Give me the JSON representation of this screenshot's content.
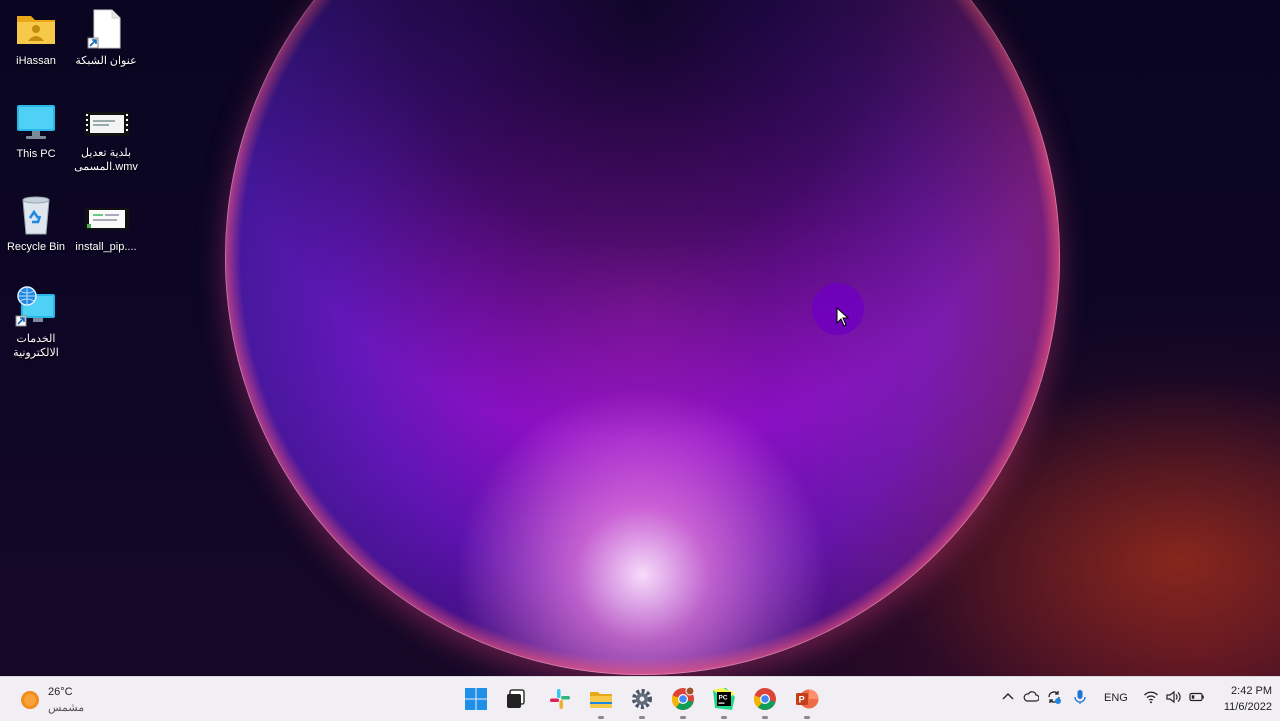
{
  "desktop_icons": [
    {
      "name": "user-folder",
      "label": "iHassan"
    },
    {
      "name": "network-address-shortcut",
      "label": "عنوان الشبكة"
    },
    {
      "name": "this-pc",
      "label": "This PC"
    },
    {
      "name": "video-file-wmv",
      "label_line1": "بلدية تعديل",
      "label_line2": "المسمى.wmv"
    },
    {
      "name": "recycle-bin",
      "label": "Recycle Bin"
    },
    {
      "name": "install-pip-file",
      "label": "install_pip...."
    },
    {
      "name": "e-services-shortcut",
      "label_line1": "الخدمات",
      "label_line2": "الالكترونية"
    }
  ],
  "taskbar": {
    "weather": {
      "temperature": "26°C",
      "condition": "مشمس",
      "icon": "sun-icon"
    },
    "pinned": [
      {
        "name": "start-button",
        "icon": "windows-logo-icon"
      },
      {
        "name": "task-view-button",
        "icon": "task-view-icon"
      },
      {
        "name": "slack-button",
        "icon": "slack-icon"
      },
      {
        "name": "file-explorer-button",
        "icon": "folder-icon"
      },
      {
        "name": "settings-button",
        "icon": "gear-icon"
      },
      {
        "name": "chrome-profile-button",
        "icon": "chrome-icon"
      },
      {
        "name": "pycharm-button",
        "icon": "pycharm-icon"
      },
      {
        "name": "chrome-button",
        "icon": "chrome-icon"
      },
      {
        "name": "powerpoint-button",
        "icon": "powerpoint-icon"
      }
    ],
    "tray": {
      "language": "ENG",
      "time": "2:42 PM",
      "date": "11/6/2022"
    }
  },
  "colors": {
    "taskbar_bg": "#f1eef4",
    "orb_core": "#b41cd6",
    "cursor_halo": "#6e00be"
  }
}
